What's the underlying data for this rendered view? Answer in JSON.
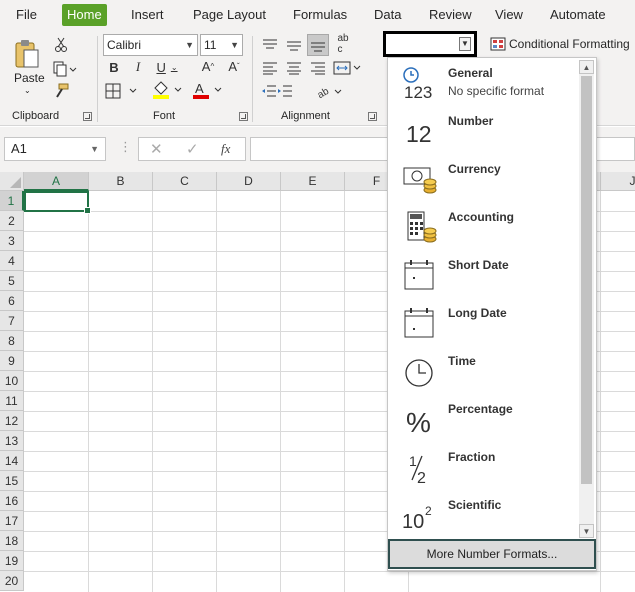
{
  "tabs": [
    "File",
    "Home",
    "Insert",
    "Page Layout",
    "Formulas",
    "Data",
    "Review",
    "View",
    "Automate"
  ],
  "active_tab": "Home",
  "clipboard": {
    "paste_label": "Paste",
    "group_label": "Clipboard"
  },
  "font": {
    "name": "Calibri",
    "size": "11",
    "group_label": "Font"
  },
  "alignment": {
    "group_label": "Alignment"
  },
  "number_format_value": "",
  "conditional_formatting_label": "Conditional Formatting",
  "name_box": "A1",
  "columns": [
    "A",
    "B",
    "C",
    "D",
    "E",
    "F",
    "J"
  ],
  "rows": [
    "1",
    "2",
    "3",
    "4",
    "5",
    "6",
    "7",
    "8",
    "9",
    "10",
    "11",
    "12",
    "13",
    "14",
    "15",
    "16",
    "17",
    "18",
    "19",
    "20"
  ],
  "selected_cell": "A1",
  "formats": [
    {
      "title": "General",
      "subtitle": "No specific format",
      "icon": "general-123-icon"
    },
    {
      "title": "Number",
      "subtitle": "",
      "icon": "number-12-icon"
    },
    {
      "title": "Currency",
      "subtitle": "",
      "icon": "currency-icon"
    },
    {
      "title": "Accounting",
      "subtitle": "",
      "icon": "accounting-icon"
    },
    {
      "title": "Short Date",
      "subtitle": "",
      "icon": "calendar-icon"
    },
    {
      "title": "Long Date",
      "subtitle": "",
      "icon": "calendar-icon"
    },
    {
      "title": "Time",
      "subtitle": "",
      "icon": "clock-icon"
    },
    {
      "title": "Percentage",
      "subtitle": "",
      "icon": "percent-icon"
    },
    {
      "title": "Fraction",
      "subtitle": "",
      "icon": "fraction-icon"
    },
    {
      "title": "Scientific",
      "subtitle": "",
      "icon": "scientific-icon"
    }
  ],
  "icon_text": {
    "general": "123",
    "number": "12",
    "percent": "%",
    "fraction_num": "1",
    "fraction_den": "2",
    "sci_base": "10",
    "sci_exp": "2"
  },
  "more_formats_label": "More Number Formats...",
  "colors": {
    "accent": "#217346",
    "tab_active": "#5aa128",
    "highlight_yellow": "#ffff00",
    "font_red": "#e00000"
  }
}
